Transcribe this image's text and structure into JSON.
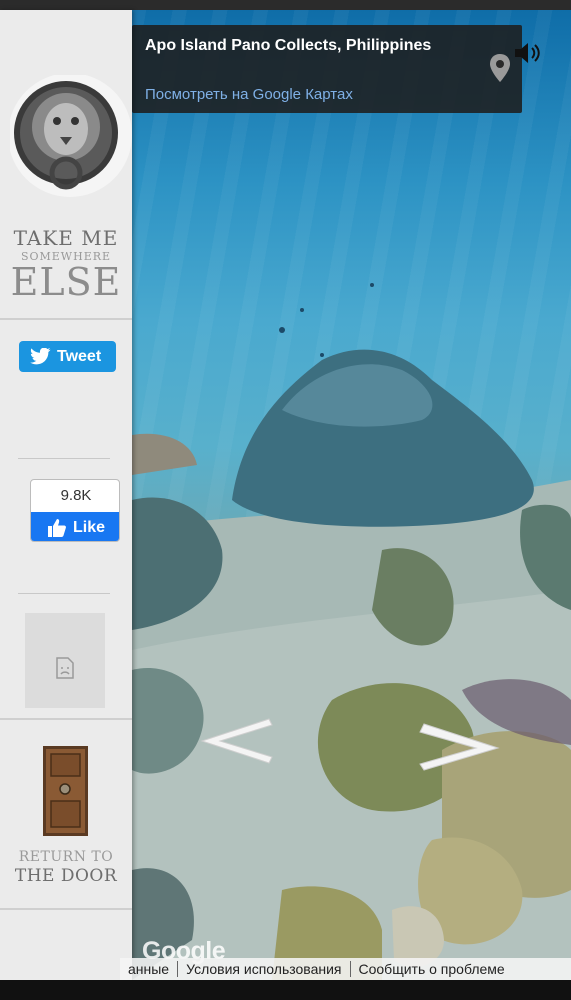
{
  "location": {
    "title": "Apo Island Pano Collects, Philippines",
    "maps_link": "Посмотреть на Google Картах"
  },
  "sidebar": {
    "take_me_line1": "TAKE ME",
    "take_me_line2": "SOMEWHERE",
    "take_me_line3": "ELSE",
    "tweet_label": "Tweet",
    "like_count": "9.8K",
    "like_label": "Like",
    "return_line1": "RETURN TO",
    "return_line2": "THE DOOR"
  },
  "footer": {
    "google_logo": "Google",
    "data_link": "анные",
    "terms_link": "Условия использования",
    "report_link": "Сообщить о проблеме"
  },
  "icons": {
    "pin": "map-pin-icon",
    "sound": "speaker-icon",
    "prev": "arrow-left-icon",
    "next": "arrow-right-icon"
  },
  "colors": {
    "twitter": "#1b95e0",
    "facebook": "#1877f2",
    "link": "#7fb0e6"
  }
}
